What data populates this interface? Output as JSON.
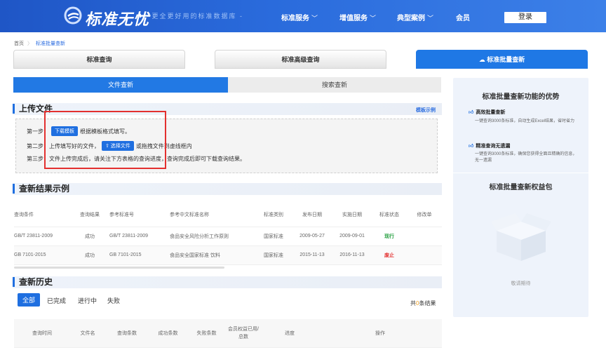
{
  "nav": {
    "brand": "标准无忧",
    "slogan": "- 更全更好用的标准数据库 -",
    "items": [
      {
        "label": "标准服务",
        "chev": "﹀"
      },
      {
        "label": "增值服务",
        "chev": "﹀"
      },
      {
        "label": "典型案例",
        "chev": "﹀"
      },
      {
        "label": "会员",
        "chev": ""
      }
    ],
    "login": "登录"
  },
  "breadcrumb": {
    "home": "首页",
    "sep": "〉",
    "current": "标准批量查新"
  },
  "tabs": {
    "query": "标准查询",
    "advanced": "标准高级查询",
    "batch": "☁ 标准批量查新"
  },
  "subtabs": {
    "file": "文件查新",
    "search": "搜索查新"
  },
  "upload": {
    "title": "上传文件",
    "sample_link": "模板示例",
    "step1_prefix": "第一步：",
    "step1_btn": "下载模板",
    "step1_suffix": "根据模板格式填写。",
    "step2_prefix": "第二步：上传填写好的文件，",
    "step2_btn": "⇧ 选择文件",
    "step2_suffix": "或拖拽文件到虚线框内",
    "step3": "第三步：文件上传完成后，请关注下方表格的查询进度，查询完成后即可下载查询结果。"
  },
  "results": {
    "title": "查新结果示例",
    "headers": [
      "查询条件",
      "查询结果",
      "参考标准号",
      "参考中文标准名称",
      "标准类别",
      "发布日期",
      "实施日期",
      "标准状态",
      "修改单"
    ],
    "rows": [
      [
        "GB/T 23811-2009",
        "成功",
        "GB/T 23811-2009",
        "食品安全风险分析工作原则",
        "国家标准",
        "2009-05-27",
        "2009-09-01",
        "现行",
        ""
      ],
      [
        "GB 7101-2015",
        "成功",
        "GB 7101-2015",
        "食品安全国家标准 饮料",
        "国家标准",
        "2015-11-13",
        "2016-11-13",
        "废止",
        ""
      ]
    ],
    "status_colors": {
      "现行": "#2ba245",
      "废止": "#e3302f"
    }
  },
  "history": {
    "title": "查新历史",
    "filters": [
      "全部",
      "已完成",
      "进行中",
      "失败"
    ],
    "total_prefix": "共",
    "total_count": "0",
    "total_suffix": "条结果",
    "headers": [
      "查询时间",
      "文件名",
      "查询条数",
      "成功条数",
      "失败条数",
      "会员权益已用/总数",
      "进度",
      "操作"
    ]
  },
  "side": {
    "title": "标准批量查新功能的优势",
    "adv1_title": "高效批量查新",
    "adv1_text": "一键查询3000条标准，自动生成Excel结果，省时省力",
    "adv2_title": "精准查询无遗漏",
    "adv2_text": "一键查询3000条标准，确保您获得全面且精确的信息，无一遗漏",
    "package_title": "标准批量查新权益包",
    "empty_text": "敬请期待"
  }
}
